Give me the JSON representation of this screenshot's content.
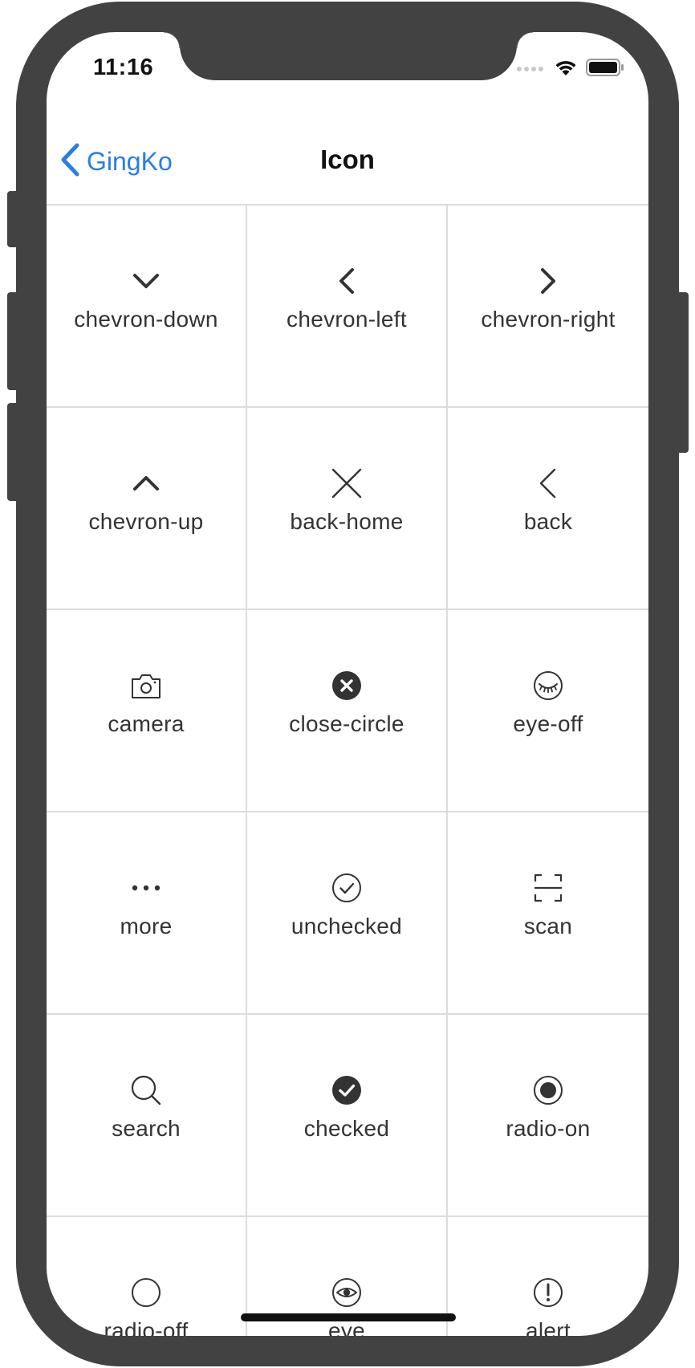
{
  "status_bar": {
    "time": "11:16"
  },
  "nav": {
    "back_label": "GingKo",
    "title": "Icon",
    "accent_color": "#2a7ee4"
  },
  "icons": [
    {
      "label": "chevron-down",
      "icon": "chevron-down-icon"
    },
    {
      "label": "chevron-left",
      "icon": "chevron-left-icon"
    },
    {
      "label": "chevron-right",
      "icon": "chevron-right-icon"
    },
    {
      "label": "chevron-up",
      "icon": "chevron-up-icon"
    },
    {
      "label": "back-home",
      "icon": "close-x-icon"
    },
    {
      "label": "back",
      "icon": "thin-chevron-left-icon"
    },
    {
      "label": "camera",
      "icon": "camera-icon"
    },
    {
      "label": "close-circle",
      "icon": "close-circle-icon"
    },
    {
      "label": "eye-off",
      "icon": "eye-off-icon"
    },
    {
      "label": "more",
      "icon": "more-dots-icon"
    },
    {
      "label": "unchecked",
      "icon": "check-outline-icon"
    },
    {
      "label": "scan",
      "icon": "scan-icon"
    },
    {
      "label": "search",
      "icon": "search-icon"
    },
    {
      "label": "checked",
      "icon": "check-filled-icon"
    },
    {
      "label": "radio-on",
      "icon": "radio-on-icon"
    },
    {
      "label": "radio-off",
      "icon": "radio-off-icon"
    },
    {
      "label": "eye",
      "icon": "eye-icon"
    },
    {
      "label": "alert",
      "icon": "alert-icon"
    }
  ]
}
